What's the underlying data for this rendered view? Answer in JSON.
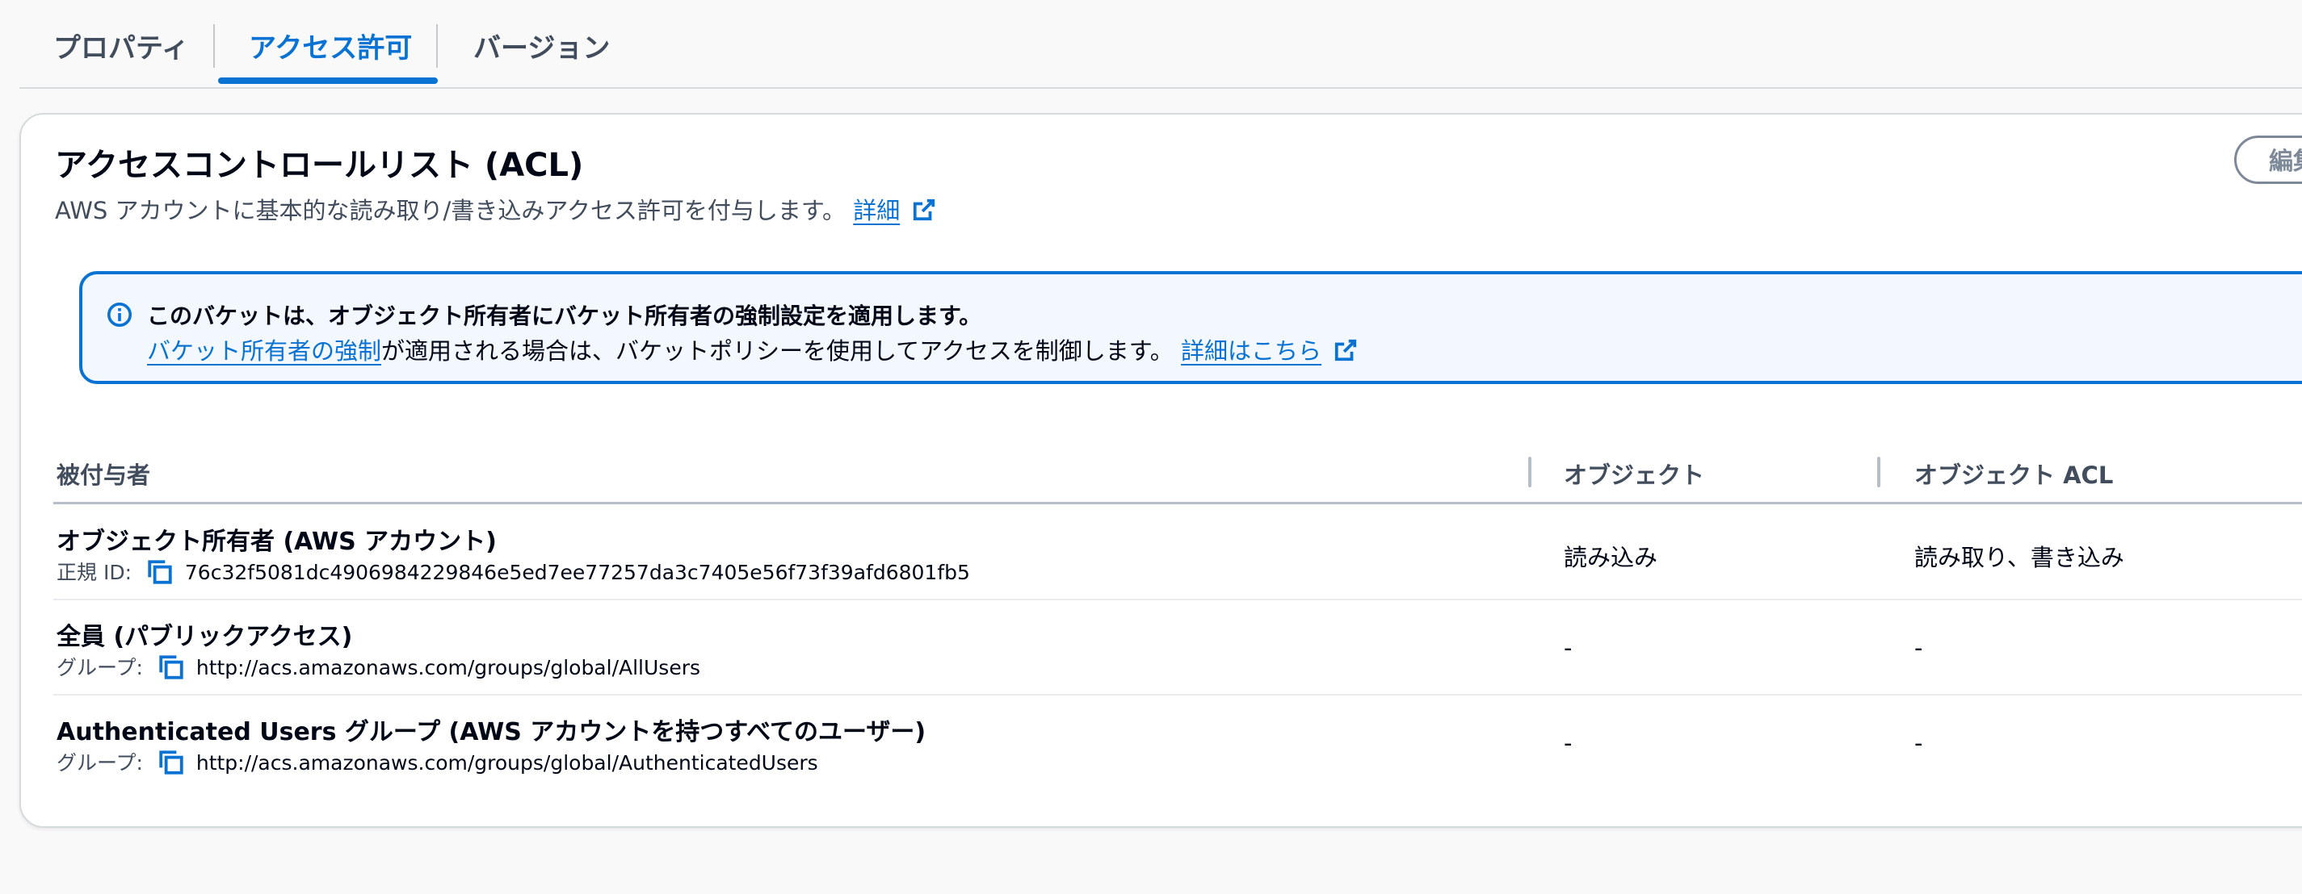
{
  "tabs": [
    {
      "label": "プロパティ"
    },
    {
      "label": "アクセス許可"
    },
    {
      "label": "バージョン"
    }
  ],
  "panel": {
    "title": "アクセスコントロールリスト (ACL)",
    "description": "AWS アカウントに基本的な読み取り/書き込みアクセス許可を付与します。",
    "details_link": "詳細",
    "edit_button": "編集"
  },
  "alert": {
    "title": "このバケットは、オブジェクト所有者にバケット所有者の強制設定を適用します。",
    "link_text": "バケット所有者の強制",
    "body_text": "が適用される場合は、バケットポリシーを使用してアクセスを制御します。",
    "learn_more": "詳細はこちら"
  },
  "table": {
    "headers": [
      "被付与者",
      "オブジェクト",
      "オブジェクト ACL"
    ],
    "rows": [
      {
        "grantee": "オブジェクト所有者 (AWS アカウント)",
        "id_label": "正規 ID:",
        "id_value": "76c32f5081dc4906984229846e5ed7ee77257da3c7405e56f73f39afd6801fb5",
        "object": "読み込み",
        "object_acl": "読み取り、書き込み"
      },
      {
        "grantee": "全員 (パブリックアクセス)",
        "id_label": "グループ:",
        "id_value": "http://acs.amazonaws.com/groups/global/AllUsers",
        "object": "-",
        "object_acl": "-"
      },
      {
        "grantee": "Authenticated Users グループ (AWS アカウントを持つすべてのユーザー)",
        "id_label": "グループ:",
        "id_value": "http://acs.amazonaws.com/groups/global/AuthenticatedUsers",
        "object": "-",
        "object_acl": "-"
      }
    ]
  },
  "colors": {
    "accent": "#0972d3",
    "text": "#000716",
    "muted": "#414d5c",
    "alert_bg": "#f2f8fd"
  }
}
